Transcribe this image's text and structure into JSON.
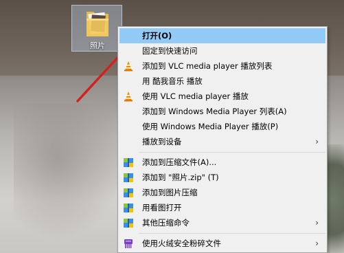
{
  "desktop": {
    "folder_label": "照片"
  },
  "menu": {
    "items": [
      {
        "label": "打开(O)",
        "bold": true,
        "icon": "",
        "submenu": false
      },
      {
        "label": "固定到快速访问",
        "icon": "",
        "submenu": false
      },
      {
        "label": "添加到 VLC media player 播放列表",
        "icon": "vlc-icon",
        "submenu": false
      },
      {
        "label": "用 酷我音乐 播放",
        "icon": "",
        "submenu": false
      },
      {
        "label": "使用 VLC media player 播放",
        "icon": "vlc-icon",
        "submenu": false
      },
      {
        "label": "添加到 Windows Media Player 列表(A)",
        "icon": "",
        "submenu": false
      },
      {
        "label": "使用 Windows Media Player 播放(P)",
        "icon": "",
        "submenu": false
      },
      {
        "label": "播放到设备",
        "icon": "",
        "submenu": true
      },
      {
        "label": "添加到压缩文件(A)...",
        "icon": "archive-icon",
        "submenu": false
      },
      {
        "label": "添加到 \"照片.zip\" (T)",
        "icon": "archive-icon",
        "submenu": false
      },
      {
        "label": "添加到图片压缩",
        "icon": "archive-icon",
        "submenu": false
      },
      {
        "label": "用看图打开",
        "icon": "archive-icon",
        "submenu": false
      },
      {
        "label": "其他压缩命令",
        "icon": "archive-icon",
        "submenu": true
      },
      {
        "label": "使用火绒安全粉碎文件",
        "icon": "shredder-icon",
        "submenu": true
      }
    ],
    "chevron": "›",
    "highlight_color": "#91c9f7"
  }
}
